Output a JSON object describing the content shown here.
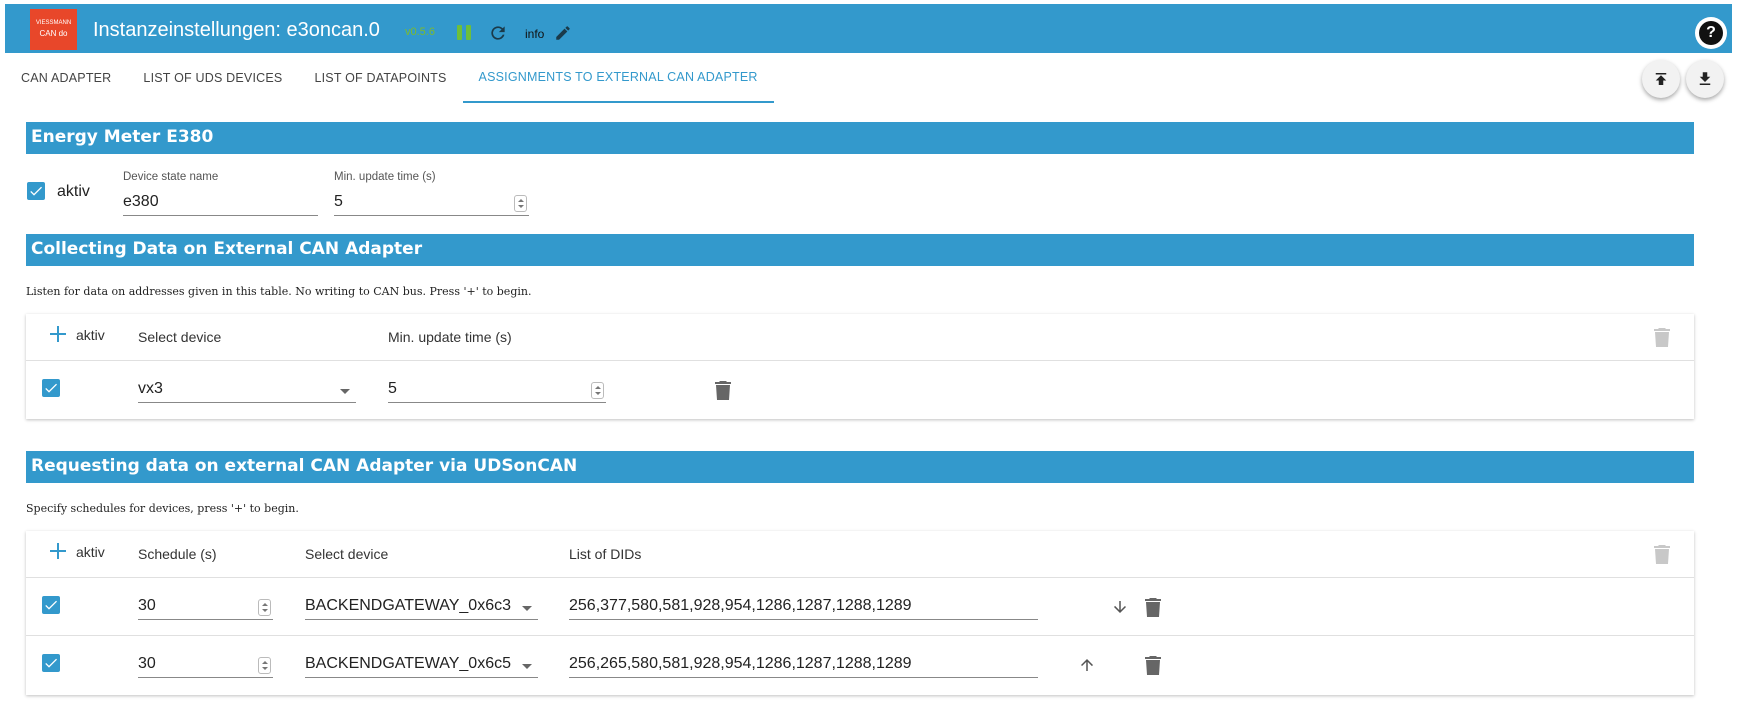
{
  "header": {
    "logo_brand": "VIESSMANN",
    "logo_sub": "CAN do",
    "title": "Instanzeinstellungen: e3oncan.0",
    "version": "v0.5.6",
    "info_label": "info",
    "help_label": "?",
    "colors": {
      "bar": "#3399cc",
      "logo": "#e8472a",
      "status": "#6ebf3a"
    }
  },
  "tabs": [
    {
      "label": "CAN ADAPTER",
      "active": false
    },
    {
      "label": "LIST OF UDS DEVICES",
      "active": false
    },
    {
      "label": "LIST OF DATAPOINTS",
      "active": false
    },
    {
      "label": "ASSIGNMENTS TO EXTERNAL CAN ADAPTER",
      "active": true
    }
  ],
  "energy_meter": {
    "title": "Energy Meter E380",
    "aktiv_label": "aktiv",
    "aktiv_checked": true,
    "device_state_label": "Device state name",
    "device_state_value": "e380",
    "min_update_label": "Min. update time (s)",
    "min_update_value": "5"
  },
  "collecting": {
    "title": "Collecting Data on External CAN Adapter",
    "description": "Listen for data on addresses given in this table. No writing to CAN bus. Press '+' to begin.",
    "columns": {
      "aktiv": "aktiv",
      "device": "Select device",
      "min_update": "Min. update time (s)"
    },
    "rows": [
      {
        "aktiv": true,
        "device": "vx3",
        "min_update": "5"
      }
    ]
  },
  "requesting": {
    "title": "Requesting data on external CAN Adapter via UDSonCAN",
    "description": "Specify schedules for devices, press '+' to begin.",
    "columns": {
      "aktiv": "aktiv",
      "schedule": "Schedule (s)",
      "device": "Select device",
      "dids": "List of DIDs"
    },
    "rows": [
      {
        "aktiv": true,
        "schedule": "30",
        "device": "BACKENDGATEWAY_0x6c3",
        "dids": "256,377,580,581,928,954,1286,1287,1288,1289"
      },
      {
        "aktiv": true,
        "schedule": "30",
        "device": "BACKENDGATEWAY_0x6c5",
        "dids": "256,265,580,581,928,954,1286,1287,1288,1289"
      }
    ]
  }
}
